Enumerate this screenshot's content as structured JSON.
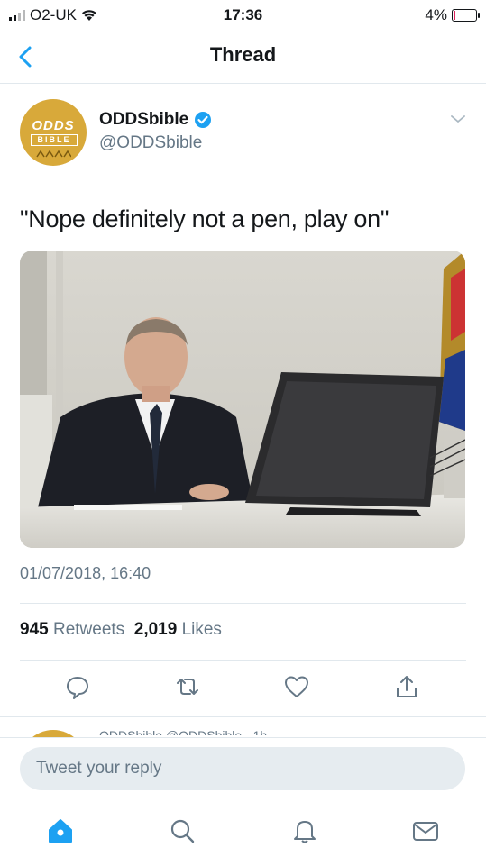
{
  "status_bar": {
    "carrier": "O2-UK",
    "time": "17:36",
    "battery": "4%"
  },
  "nav": {
    "title": "Thread"
  },
  "tweet": {
    "display_name": "ODDSbible",
    "handle": "@ODDSbible",
    "avatar_text": "ODDS",
    "avatar_subtext": "BIBLE",
    "text": "\"Nope definitely not a pen, play on\"",
    "timestamp": "01/07/2018, 16:40",
    "retweets_count": "945",
    "retweets_label": "Retweets",
    "likes_count": "2,019",
    "likes_label": "Likes"
  },
  "next_tweet_peek": "ODDSbible @ODDSbible · 1h",
  "reply": {
    "placeholder": "Tweet your reply"
  },
  "tabs": [
    "home-icon",
    "search-icon",
    "notifications-icon",
    "messages-icon"
  ],
  "colors": {
    "accent": "#1da1f2",
    "muted": "#657786",
    "divider": "#e1e8ed",
    "avatar": "#d8a93a"
  }
}
